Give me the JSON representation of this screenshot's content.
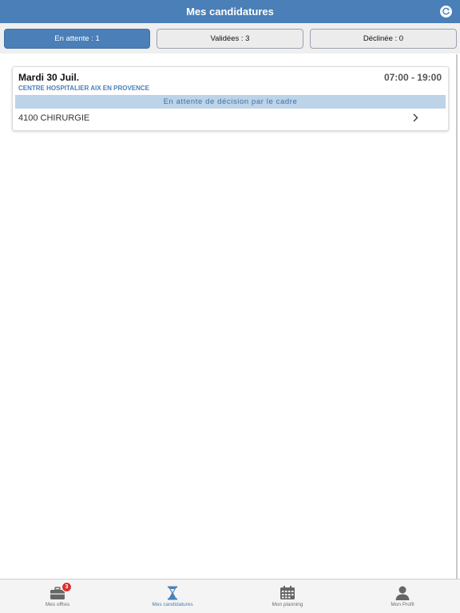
{
  "header": {
    "title": "Mes candidatures",
    "refresh_icon": "refresh-icon",
    "color": "#4a7fb8"
  },
  "tabs": [
    {
      "label": "En attente : 1",
      "active": true
    },
    {
      "label": "Validées : 3",
      "active": false
    },
    {
      "label": "Déclinée : 0",
      "active": false
    }
  ],
  "cards": [
    {
      "date": "Mardi 30 Juil.",
      "time": "07:00 - 19:00",
      "hospital": "CENTRE HOSPITALIER AIX EN PROVENCE",
      "status": "En attente de décision par le cadre",
      "service": "4100 CHIRURGIE",
      "chevron_icon": "chevron-right-icon"
    }
  ],
  "tabbar": [
    {
      "label": "Mes offres",
      "icon": "briefcase-icon",
      "badge": "3",
      "active": false
    },
    {
      "label": "Mes candidatures",
      "icon": "hourglass-icon",
      "active": true
    },
    {
      "label": "Mon planning",
      "icon": "calendar-icon",
      "active": false
    },
    {
      "label": "Mon Profil",
      "icon": "user-icon",
      "active": false
    }
  ]
}
